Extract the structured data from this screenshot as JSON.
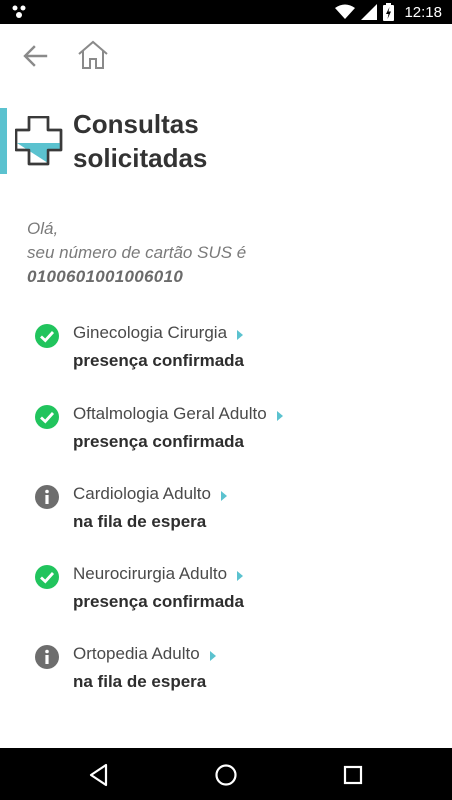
{
  "status_bar": {
    "time": "12:18"
  },
  "header": {
    "title_line1": "Consultas",
    "title_line2": "solicitadas"
  },
  "greeting": {
    "hello": "Olá,",
    "message": "seu número de cartão SUS é",
    "card_number": "0100601001006010"
  },
  "consultations": [
    {
      "specialty": "Ginecologia Cirurgia",
      "status": "presença confirmada",
      "status_icon": "check-circle-icon"
    },
    {
      "specialty": "Oftalmologia Geral Adulto",
      "status": "presença confirmada",
      "status_icon": "check-circle-icon"
    },
    {
      "specialty": "Cardiologia Adulto",
      "status": "na fila de espera",
      "status_icon": "info-circle-icon"
    },
    {
      "specialty": "Neurocirurgia Adulto",
      "status": "presença confirmada",
      "status_icon": "check-circle-icon"
    },
    {
      "specialty": "Ortopedia Adulto",
      "status": "na fila de espera",
      "status_icon": "info-circle-icon"
    }
  ],
  "colors": {
    "accent": "#5bc2cf",
    "confirmed": "#21c45d",
    "waiting": "#6d6d6d",
    "text_dark": "#333333"
  }
}
